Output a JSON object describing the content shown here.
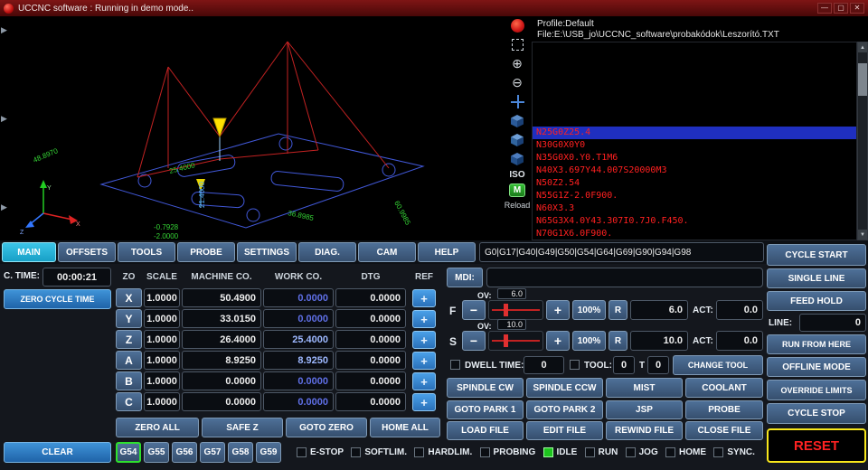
{
  "window": {
    "title": "UCCNC software : Running in demo mode..",
    "minimize": "—",
    "maximize": "▢",
    "close": "✕"
  },
  "icons": {
    "expander": "▶",
    "zoom_in": "⊕",
    "zoom_out": "⊖",
    "scroll_up": "▲",
    "scroll_down": "▼",
    "ref": "+"
  },
  "view_toolbar": {
    "iso": "ISO",
    "m": "M",
    "reload": "Reload"
  },
  "viewport": {
    "dim_labels": [
      {
        "text": "48.8970"
      },
      {
        "text": "25.4000"
      },
      {
        "text": "21.4000"
      },
      {
        "text": "-0.7928"
      },
      {
        "text": "-2.0000"
      },
      {
        "text": "36.8985"
      },
      {
        "text": "60.9985"
      }
    ],
    "axis": {
      "x": "X",
      "y": "Y",
      "z": "Z"
    }
  },
  "gcode_panel": {
    "profile": "Profile:Default",
    "file": "File:E:\\USB_jo\\UCCNC_software\\probakódok\\Leszorító.TXT",
    "lines": [
      "N25G0Z25.4",
      "N30G0X0Y0",
      "N35G0X0.Y0.T1M6",
      "N40X3.697Y44.007S20000M3",
      "N50Z2.54",
      "N55G1Z-2.0F900.",
      "N60X3.3",
      "N65G3X4.0Y43.307I0.7J0.F450.",
      "N70G1X6.0F900."
    ]
  },
  "tabs": [
    {
      "label": "MAIN"
    },
    {
      "label": "OFFSETS"
    },
    {
      "label": "TOOLS"
    },
    {
      "label": "PROBE"
    },
    {
      "label": "SETTINGS"
    },
    {
      "label": "DIAG."
    },
    {
      "label": "CAM"
    },
    {
      "label": "HELP"
    }
  ],
  "modal_gcodes": "G0|G17|G40|G49|G50|G54|G64|G69|G90|G94|G98",
  "cycle_time": {
    "label": "C. TIME:",
    "value": "00:00:21",
    "zero_button": "ZERO CYCLE TIME",
    "clear_button": "CLEAR"
  },
  "dro": {
    "headers": {
      "axis": "ZO",
      "scale": "SCALE",
      "machine": "MACHINE CO.",
      "work": "WORK CO.",
      "dtg": "DTG",
      "ref": "REF"
    },
    "rows": [
      {
        "axis": "X",
        "scale": "1.0000",
        "machine": "50.4900",
        "work": "0.0000",
        "dtg": "0.0000"
      },
      {
        "axis": "Y",
        "scale": "1.0000",
        "machine": "33.0150",
        "work": "0.0000",
        "dtg": "0.0000"
      },
      {
        "axis": "Z",
        "scale": "1.0000",
        "machine": "26.4000",
        "work": "25.4000",
        "dtg": "0.0000"
      },
      {
        "axis": "A",
        "scale": "1.0000",
        "machine": "8.9250",
        "work": "8.9250",
        "dtg": "0.0000"
      },
      {
        "axis": "B",
        "scale": "1.0000",
        "machine": "0.0000",
        "work": "0.0000",
        "dtg": "0.0000"
      },
      {
        "axis": "C",
        "scale": "1.0000",
        "machine": "0.0000",
        "work": "0.0000",
        "dtg": "0.0000"
      }
    ],
    "footer": {
      "zero_all": "ZERO ALL",
      "safe_z": "SAFE Z",
      "goto_zero": "GOTO ZERO",
      "home_all": "HOME ALL"
    },
    "offsets": [
      {
        "label": "G54"
      },
      {
        "label": "G55"
      },
      {
        "label": "G56"
      },
      {
        "label": "G57"
      },
      {
        "label": "G58"
      },
      {
        "label": "G59"
      }
    ]
  },
  "mdi": {
    "label": "MDI:",
    "value": ""
  },
  "feed": {
    "letter": "F",
    "ov_label": "OV:",
    "ov_value": "6.0",
    "minus": "−",
    "plus": "+",
    "percent": "100%",
    "reset": "R",
    "value": "6.0",
    "act_label": "ACT:",
    "act_value": "0.0"
  },
  "spindle": {
    "letter": "S",
    "ov_label": "OV:",
    "ov_value": "10.0",
    "minus": "−",
    "plus": "+",
    "percent": "100%",
    "reset": "R",
    "value": "10.0",
    "act_label": "ACT:",
    "act_value": "0.0"
  },
  "tool_row": {
    "dwell_label": "DWELL TIME:",
    "dwell_value": "0",
    "tool_label": "TOOL:",
    "tool_value": "0",
    "t_label": "T",
    "t_value": "0",
    "change_tool": "CHANGE TOOL"
  },
  "action_buttons": {
    "row1": [
      "SPINDLE CW",
      "SPINDLE CCW",
      "MIST",
      "COOLANT"
    ],
    "row2": [
      "GOTO PARK 1",
      "GOTO PARK 2",
      "JSP",
      "PROBE"
    ],
    "row3": [
      "LOAD FILE",
      "EDIT FILE",
      "REWIND FILE",
      "CLOSE FILE"
    ]
  },
  "status_row": [
    {
      "label": "E-STOP",
      "on": false
    },
    {
      "label": "SOFTLIM.",
      "on": false
    },
    {
      "label": "HARDLIM.",
      "on": false
    },
    {
      "label": "PROBING",
      "on": false
    },
    {
      "label": "IDLE",
      "on": true
    },
    {
      "label": "RUN",
      "on": false
    },
    {
      "label": "JOG",
      "on": false
    },
    {
      "label": "HOME",
      "on": false
    },
    {
      "label": "SYNC.",
      "on": false
    }
  ],
  "right_panel": {
    "cycle_start": "CYCLE START",
    "single_line": "SINGLE LINE",
    "feed_hold": "FEED HOLD",
    "line_label": "LINE:",
    "line_value": "0",
    "run_from_here": "RUN FROM HERE",
    "offline_mode": "OFFLINE MODE",
    "override_limits": "OVERRIDE LIMITS",
    "cycle_stop": "CYCLE STOP",
    "reset": "RESET"
  },
  "colors": {
    "accent_cyan": "#2ab4d8",
    "button_slate": "#3c5877",
    "button_blue": "#2f7dc0",
    "selected_line_bg": "#1f2fc0",
    "gcode_red": "#ff2020",
    "dim_green": "#35d435",
    "work_blue": "#5f6fe6",
    "work_bright": "#9db8ff",
    "status_green": "#1ec41e",
    "reset_border": "#f8e71c",
    "reset_text": "#ff2222"
  }
}
